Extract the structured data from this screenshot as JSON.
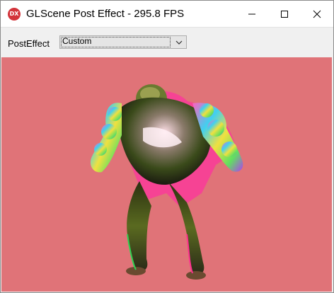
{
  "window": {
    "title": "GLScene Post Effect - 295.8 FPS",
    "app_icon_text": "DX",
    "controls": [
      "minimize-icon",
      "maximize-icon",
      "close-icon"
    ]
  },
  "toolbar": {
    "post_effect_label": "PostEffect",
    "post_effect_select": {
      "value": "Custom",
      "icon": "chevron-down-icon"
    }
  },
  "viewport": {
    "background_color": "#e07378",
    "subject": "3d-character-model"
  },
  "colors": {
    "titlebar_bg": "#ffffff",
    "toolbar_bg": "#f0f0f0",
    "app_icon": "#d3343a"
  }
}
